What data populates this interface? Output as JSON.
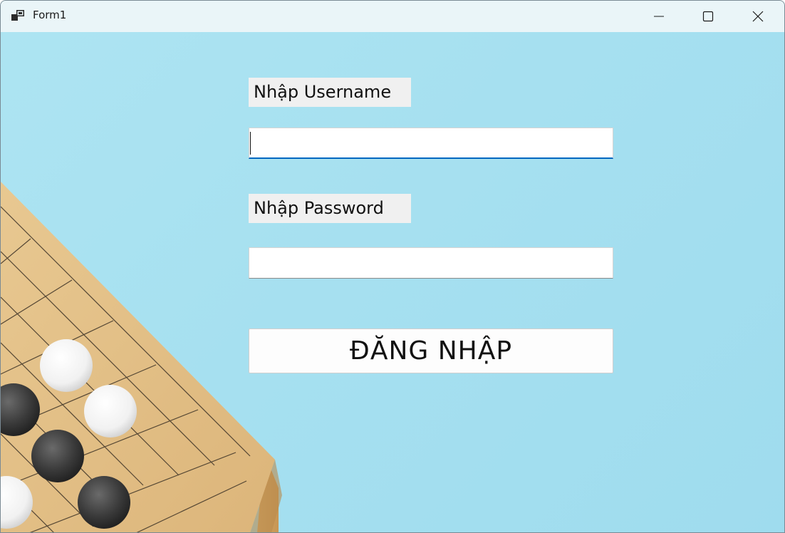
{
  "window": {
    "title": "Form1"
  },
  "form": {
    "username_label": "Nhập Username",
    "username_value": "",
    "password_label": "Nhập Password",
    "password_value": "",
    "login_button": "ĐĂNG NHẬP"
  },
  "icons": {
    "app": "app-window-icon",
    "minimize": "minimize-icon",
    "maximize": "maximize-icon",
    "close": "close-icon"
  },
  "colors": {
    "background": "#a8e0ee",
    "titlebar": "#eaf5f8",
    "focus_accent": "#0067c0",
    "label_bg": "#f0f0f0"
  }
}
